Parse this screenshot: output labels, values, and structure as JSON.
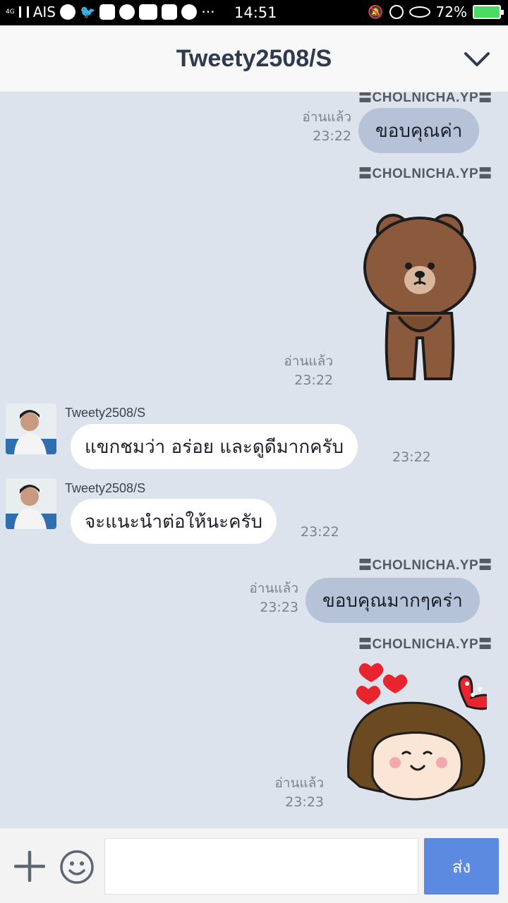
{
  "status_bar": {
    "network": "4G",
    "carrier": "AIS",
    "more": "···",
    "time": "14:51",
    "battery_pct": "72%",
    "battery_level": 0.72
  },
  "header": {
    "title": "Tweety2508/S",
    "chevron_icon": "chevron-down-icon"
  },
  "chat": {
    "watermark": "〓CHOLNICHA.YP〓",
    "messages": [
      {
        "dir": "out",
        "text": "ขอบคุณค่า",
        "status": "อ่านแล้ว",
        "time": "23:22"
      },
      {
        "dir": "out",
        "sticker": "bear-sticker",
        "status": "อ่านแล้ว",
        "time": "23:22"
      },
      {
        "dir": "in",
        "sender": "Tweety2508/S",
        "text": "แขกชมว่า อร่อย และดูดีมากครับ",
        "time": "23:22"
      },
      {
        "dir": "in",
        "sender": "Tweety2508/S",
        "text": "จะแนะนำต่อให้นะครับ",
        "time": "23:22"
      },
      {
        "dir": "out",
        "text": "ขอบคุณมากๆคร่า",
        "status": "อ่านแล้ว",
        "time": "23:23"
      },
      {
        "dir": "out",
        "sticker": "girl-hearts-sticker",
        "status": "อ่านแล้ว",
        "time": "23:23"
      }
    ]
  },
  "input_bar": {
    "plus_icon": "plus-icon",
    "emoji_icon": "smiley-icon",
    "placeholder": "",
    "send_label": "ส่ง"
  },
  "colors": {
    "chat_bg": "#dde3ec",
    "outgoing_bubble": "#b5c2d8",
    "incoming_bubble": "#ffffff",
    "send_button": "#5b8ae0"
  }
}
